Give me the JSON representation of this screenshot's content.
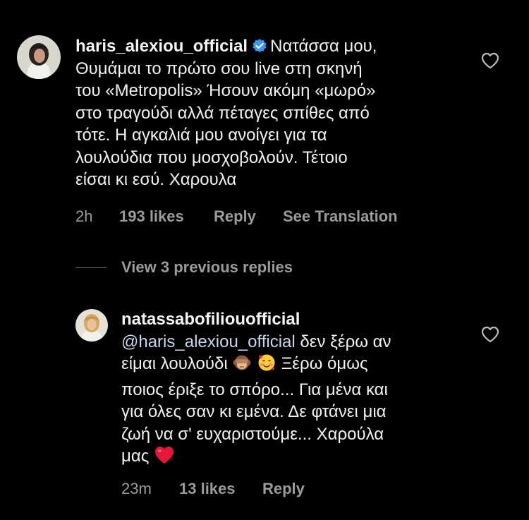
{
  "comment1": {
    "username": "haris_alexiou_official",
    "text_lines": [
      "Νατάσσα μου,",
      "Θυμάμαι το πρώτο σου live στη σκηνή",
      "του «Metropolis»  Ήσουν ακόμη «μωρό»",
      "στο τραγούδι αλλά πέταγες σπίθες από",
      "τότε. Η αγκαλιά μου ανοίγει για τα",
      "λουλούδια που μοσχοβολούν.  Τέτοιο",
      "είσαι κι εσύ.  Χαρουλα"
    ],
    "time": "2h",
    "likes": "193 likes",
    "reply": "Reply",
    "see_translation": "See Translation",
    "verified_color": "#3897f0"
  },
  "view_previous_replies": "View 3 previous replies",
  "comment2": {
    "username": "natassabofiliouofficial",
    "mention": "@haris_alexiou_official",
    "line1_rest": " δεν ξέρω αν",
    "line2": "είμαι λουλούδι",
    "line2_after": "Ξέρω όμως",
    "line3": "ποιος έριξε το σπόρο... Για μένα και",
    "line4": "για όλες σαν κι εμένα. Δε φτάνει μια",
    "line5": "ζωή να σ' ευχαριστούμε... Χαρούλα",
    "line6": "μας",
    "time": "23m",
    "likes": "13 likes",
    "reply": "Reply",
    "emojis": [
      "see-no-evil-monkey",
      "smiling-face-with-hearts",
      "red-heart"
    ]
  },
  "colors": {
    "background": "#000000",
    "text": "#f2f2f2",
    "meta": "#9b9b9b",
    "mention": "#c7d7ee",
    "heart_emoji": "#e0245e"
  }
}
